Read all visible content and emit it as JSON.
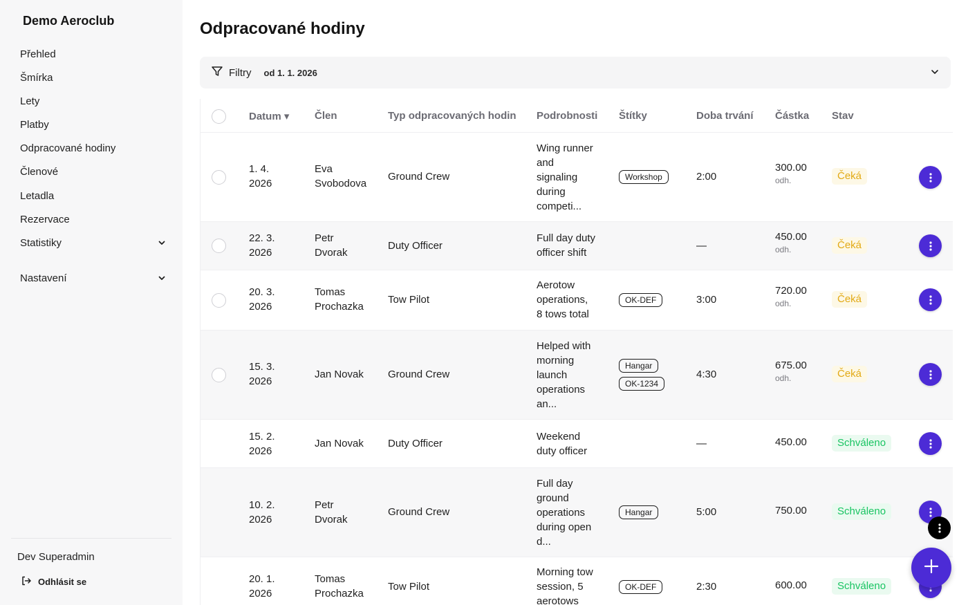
{
  "sidebar": {
    "brand": "Demo Aeroclub",
    "items": [
      {
        "label": "Přehled"
      },
      {
        "label": "Šmírka"
      },
      {
        "label": "Lety"
      },
      {
        "label": "Platby"
      },
      {
        "label": "Odpracované hodiny"
      },
      {
        "label": "Členové"
      },
      {
        "label": "Letadla"
      },
      {
        "label": "Rezervace"
      },
      {
        "label": "Statistiky"
      },
      {
        "label": "Nastavení"
      }
    ],
    "user": "Dev Superadmin",
    "logout": "Odhlásit se"
  },
  "page": {
    "title": "Odpracované hodiny"
  },
  "filter": {
    "label": "Filtry",
    "date": "od 1. 1. 2026"
  },
  "table": {
    "headers": {
      "date": "Datum ▾",
      "member": "Člen",
      "type": "Typ odpracovaných hodin",
      "details": "Podrobnosti",
      "tags": "Štítky",
      "duration": "Doba trvání",
      "amount": "Částka",
      "status": "Stav"
    },
    "rows": [
      {
        "date1": "1. 4.",
        "date2": "2026",
        "member1": "Eva",
        "member2": "Svobodova",
        "type": "Ground Crew",
        "details": [
          "Wing runner",
          "and",
          "signaling",
          "during",
          "competi..."
        ],
        "tags": [
          "Workshop"
        ],
        "duration": "2:00",
        "amount": "300.00",
        "amount_sub": "odh.",
        "status": "Čeká"
      },
      {
        "date1": "22. 3.",
        "date2": "2026",
        "member1": "Petr",
        "member2": "Dvorak",
        "type": "Duty Officer",
        "details": [
          "Full day duty",
          "officer shift"
        ],
        "tags": [],
        "duration": "—",
        "amount": "450.00",
        "amount_sub": "odh.",
        "status": "Čeká"
      },
      {
        "date1": "20. 3.",
        "date2": "2026",
        "member1": "Tomas",
        "member2": "Prochazka",
        "type": "Tow Pilot",
        "details": [
          "Aerotow",
          "operations,",
          "8 tows total"
        ],
        "tags": [
          "OK-DEF"
        ],
        "duration": "3:00",
        "amount": "720.00",
        "amount_sub": "odh.",
        "status": "Čeká"
      },
      {
        "date1": "15. 3.",
        "date2": "2026",
        "member1": "Jan Novak",
        "member2": "",
        "type": "Ground Crew",
        "details": [
          "Helped with",
          "morning",
          "launch",
          "operations",
          "an..."
        ],
        "tags": [
          "Hangar",
          "OK-1234"
        ],
        "duration": "4:30",
        "amount": "675.00",
        "amount_sub": "odh.",
        "status": "Čeká"
      },
      {
        "date1": "15. 2.",
        "date2": "2026",
        "member1": "Jan Novak",
        "member2": "",
        "type": "Duty Officer",
        "details": [
          "Weekend",
          "duty officer"
        ],
        "tags": [],
        "duration": "—",
        "amount": "450.00",
        "amount_sub": "",
        "status": "Schváleno"
      },
      {
        "date1": "10. 2.",
        "date2": "2026",
        "member1": "Petr",
        "member2": "Dvorak",
        "type": "Ground Crew",
        "details": [
          "Full day",
          "ground",
          "operations",
          "during open",
          "d..."
        ],
        "tags": [
          "Hangar"
        ],
        "duration": "5:00",
        "amount": "750.00",
        "amount_sub": "",
        "status": "Schváleno"
      },
      {
        "date1": "20. 1.",
        "date2": "2026",
        "member1": "Tomas",
        "member2": "Prochazka",
        "type": "Tow Pilot",
        "details": [
          "Morning tow",
          "session, 5",
          "aerotows"
        ],
        "tags": [
          "OK-DEF"
        ],
        "duration": "2:30",
        "amount": "600.00",
        "amount_sub": "",
        "status": "Schváleno"
      }
    ]
  },
  "colors": {
    "accent": "#4c2bd6",
    "pending": "#e2a914",
    "approved": "#19c462"
  },
  "icons": {
    "filter": "filter-icon",
    "chevron": "chevron-down-icon",
    "logout": "logout-icon",
    "more": "more-vertical-icon",
    "add": "plus-icon"
  }
}
